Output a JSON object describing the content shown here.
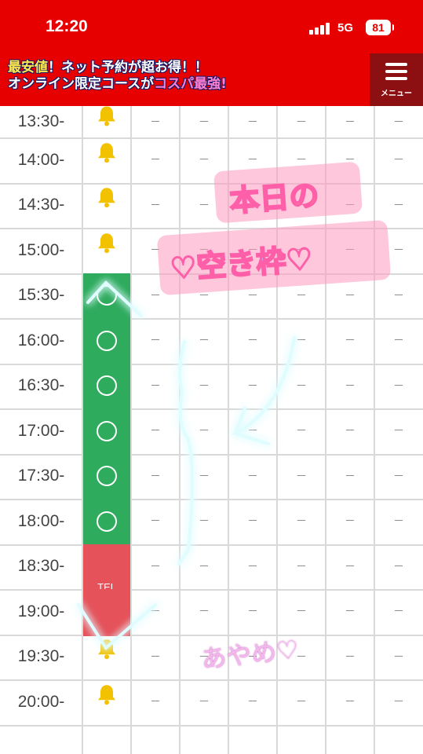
{
  "status_bar": {
    "time": "12:20",
    "network": "5G",
    "battery": "81"
  },
  "banner": {
    "line1_a": "最安値",
    "line1_b": "！ネット予約が超お得！！",
    "line2_a": "オンライン限定コースが",
    "line2_b": "コスパ最強!"
  },
  "menu": {
    "label": "メニュー",
    "icon": "hamburger-icon"
  },
  "schedule": {
    "times": [
      "13:30-",
      "14:00-",
      "14:30-",
      "15:00-",
      "15:30-",
      "16:00-",
      "16:30-",
      "17:00-",
      "17:30-",
      "18:00-",
      "18:30-",
      "19:00-",
      "19:30-",
      "20:00-"
    ],
    "first_column": [
      "bell",
      "bell",
      "bell",
      "bell",
      "available",
      "available",
      "available",
      "available",
      "available",
      "available",
      "tel",
      "tel",
      "bell",
      "bell"
    ],
    "tel_label": "TEL",
    "empty_mark": "－",
    "colors": {
      "available": "#2fab5e",
      "tel": "#e5525a",
      "bell": "#f2c200",
      "header": "#e60000"
    }
  },
  "overlay": {
    "sticker_line1": "本日の",
    "sticker_line2": "♡空き枠♡",
    "signature": "あやめ♡"
  }
}
